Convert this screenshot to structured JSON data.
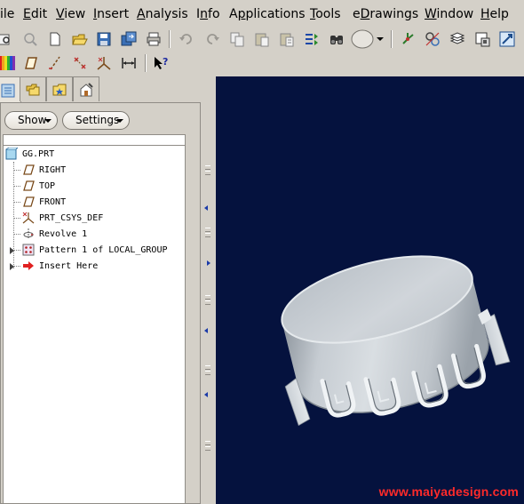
{
  "menubar": {
    "items": [
      {
        "label": "ile",
        "underline": ""
      },
      {
        "label": "Edit",
        "underline": "E"
      },
      {
        "label": "View",
        "underline": "V"
      },
      {
        "label": "Insert",
        "underline": "I"
      },
      {
        "label": "Analysis",
        "underline": "A"
      },
      {
        "label": "Info",
        "underline": "n"
      },
      {
        "label": "Applications",
        "underline": "p"
      },
      {
        "label": "Tools",
        "underline": "T"
      },
      {
        "label": "eDrawings",
        "underline": "D"
      },
      {
        "label": "Window",
        "underline": "W"
      },
      {
        "label": "Help",
        "underline": "H"
      }
    ]
  },
  "toolbar1": {
    "icons": [
      "open-partial-icon",
      "regenerate-icon",
      "new-file-icon",
      "open-folder-icon",
      "save-icon",
      "save-copy-icon",
      "print-icon",
      "undo-icon",
      "redo-icon",
      "copy-icon",
      "paste-icon",
      "paste-special-icon",
      "regenerate-manager-icon",
      "find-icon",
      "view-dropdown-icon",
      "datum-display-icon",
      "selection-filter-icon",
      "layers-icon",
      "sketch-view-icon",
      "help-context-icon"
    ]
  },
  "toolbar2": {
    "icons": [
      "color-appearance-icon",
      "datum-plane-icon",
      "datum-axis-icon",
      "datum-point-icon",
      "coordinate-system-icon",
      "measure-icon",
      "whats-this-icon"
    ]
  },
  "panel": {
    "tabs": [
      "model-tree-tab",
      "folder-browser-tab",
      "favorites-tab",
      "connections-tab"
    ],
    "show_label": "Show",
    "settings_label": "Settings"
  },
  "tree": {
    "root": "GG.PRT",
    "items": [
      {
        "label": "RIGHT",
        "icon": "datum-plane-icon"
      },
      {
        "label": "TOP",
        "icon": "datum-plane-icon"
      },
      {
        "label": "FRONT",
        "icon": "datum-plane-icon"
      },
      {
        "label": "PRT_CSYS_DEF",
        "icon": "coordinate-system-icon"
      },
      {
        "label": "Revolve 1",
        "icon": "revolve-icon"
      },
      {
        "label": "Pattern 1 of LOCAL_GROUP",
        "icon": "pattern-icon"
      },
      {
        "label": "Insert Here",
        "icon": "insert-arrow-icon"
      }
    ]
  },
  "viewport": {
    "background": "#05123e",
    "watermark": "www.maiyadesign.com",
    "watermark_color": "#ff2a2a"
  }
}
